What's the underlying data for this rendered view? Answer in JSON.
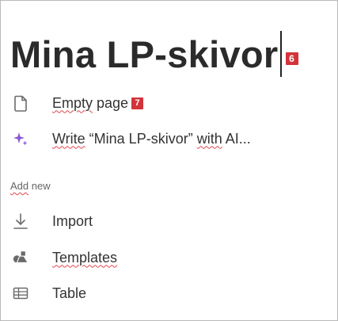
{
  "page": {
    "title": "Mina LP-skivor",
    "title_badge": "6"
  },
  "menu": {
    "empty_page": {
      "label_part1": "Empty",
      "label_part2": " page",
      "badge": "7"
    },
    "write_ai": {
      "label_part1": "Write",
      " label_part2": "",
      "label_quoted": " “Mina LP-skivor” ",
      "label_with": "with",
      "label_rest": " AI..."
    }
  },
  "add_new": {
    "heading_part1": "Add",
    "heading_part2": " new",
    "items": [
      {
        "label": "Import",
        "icon": "import-arrow-icon"
      },
      {
        "label": "Templates",
        "icon": "templates-shapes-icon"
      },
      {
        "label": "Table",
        "icon": "table-grid-icon"
      }
    ]
  },
  "colors": {
    "badge": "#d2343a",
    "ai_sparkle": "#8a56d6",
    "spellcheck": "#e0474d"
  }
}
